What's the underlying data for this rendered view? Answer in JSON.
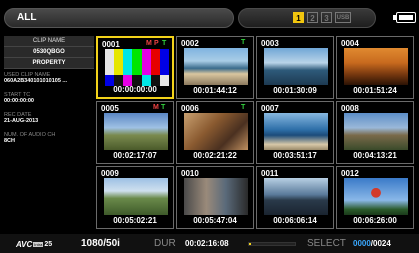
{
  "header": {
    "title": "ALL",
    "pages": [
      "1",
      "2",
      "3",
      "USB"
    ],
    "active_page": 0,
    "battery_icon": "battery-icon"
  },
  "sidebar": {
    "clip_name_label": "CLIP NAME",
    "clip_name": "0530QBGO",
    "property_button": "PROPERTY",
    "used_clip_name_label": "USED CLIP NAME",
    "used_clip_name": "060A2B340101010105 ...",
    "start_tc_label": "START TC",
    "start_tc": "00:00:00:00",
    "rec_date_label": "REC DATE",
    "rec_date": "21-AUG-2013",
    "audio_ch_label": "NUM. OF AUDIO CH",
    "audio_ch": "8CH"
  },
  "clips": [
    {
      "number": "0001",
      "badges": [
        "M",
        "P",
        "T"
      ],
      "timecode": "00:00:00:00",
      "thumb": "color-bars",
      "selected": true
    },
    {
      "number": "0002",
      "badges": [
        "T"
      ],
      "timecode": "00:01:44:12",
      "thumb": "city-bay",
      "selected": false
    },
    {
      "number": "0003",
      "badges": [],
      "timecode": "00:01:30:09",
      "thumb": "harbor",
      "selected": false
    },
    {
      "number": "0004",
      "badges": [],
      "timecode": "00:01:51:24",
      "thumb": "sunset",
      "selected": false
    },
    {
      "number": "0005",
      "badges": [
        "M",
        "T"
      ],
      "timecode": "00:02:17:07",
      "thumb": "mountain",
      "selected": false
    },
    {
      "number": "0006",
      "badges": [
        "T"
      ],
      "timecode": "00:02:21:22",
      "thumb": "people",
      "selected": false
    },
    {
      "number": "0007",
      "badges": [],
      "timecode": "00:03:51:17",
      "thumb": "coast",
      "selected": false
    },
    {
      "number": "0008",
      "badges": [],
      "timecode": "00:04:13:21",
      "thumb": "rock",
      "selected": false
    },
    {
      "number": "0009",
      "badges": [],
      "timecode": "00:05:02:21",
      "thumb": "valley",
      "selected": false
    },
    {
      "number": "0010",
      "badges": [],
      "timecode": "00:05:47:04",
      "thumb": "street",
      "selected": false
    },
    {
      "number": "0011",
      "badges": [],
      "timecode": "00:06:06:14",
      "thumb": "ship",
      "selected": false
    },
    {
      "number": "0012",
      "badges": [],
      "timecode": "00:06:26:00",
      "thumb": "balloon",
      "selected": false
    }
  ],
  "footer": {
    "codec": "AVC",
    "codec_sub": "Intra",
    "codec_rate": "25",
    "format": "1080/50i",
    "dur_label": "DUR",
    "dur_value": "00:02:16:08",
    "progress": 0.05,
    "select_label": "SELECT",
    "selected_count": "0000",
    "total_count": "/0024"
  },
  "colors": {
    "accent": "#f2d21a",
    "mark_red": "#f04343",
    "mark_green": "#31d13c",
    "count_blue": "#3aa8ff"
  }
}
